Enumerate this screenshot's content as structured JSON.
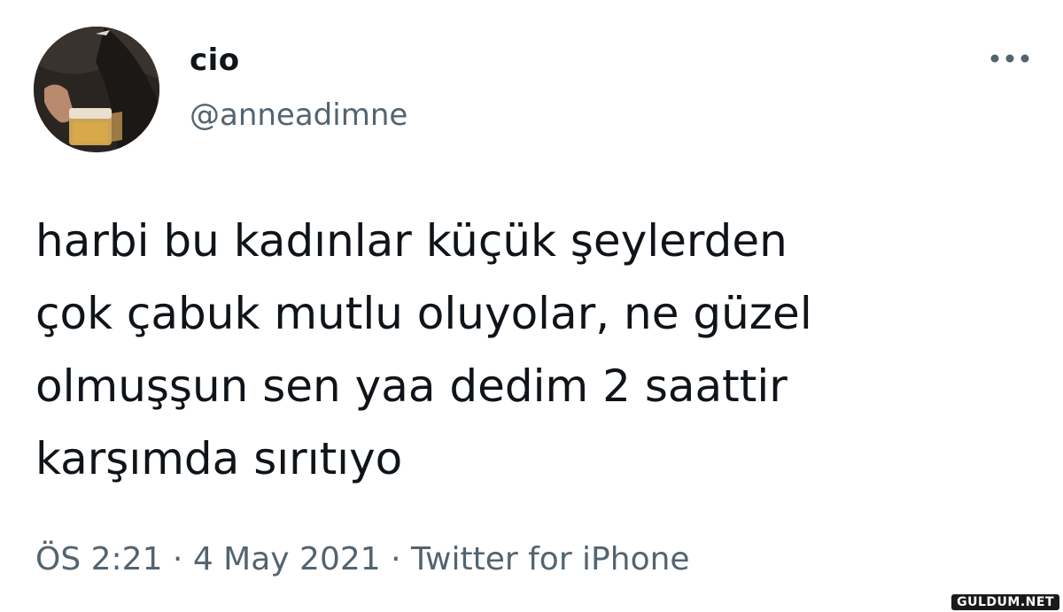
{
  "tweet": {
    "author": {
      "display_name": "cio",
      "handle": "@anneadimne"
    },
    "text_lines": [
      "harbi bu kadınlar küçük şeylerden",
      "çok çabuk mutlu oluyolar, ne güzel",
      "olmuşşun sen yaa dedim 2 saattir",
      "karşımda sırıtıyo"
    ],
    "time": "ÖS 2:21",
    "date": "4 May 2021",
    "source": "Twitter for iPhone",
    "separator": " · "
  },
  "watermark": "GULDUM.NET",
  "icons": {
    "more": "more-horizontal-icon",
    "avatar": "avatar-photo"
  },
  "colors": {
    "text": "#0f1419",
    "secondary": "#536471",
    "background": "#ffffff"
  }
}
